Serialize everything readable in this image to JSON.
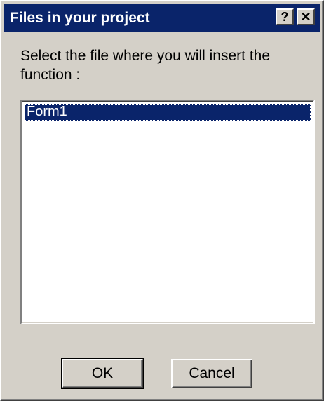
{
  "window": {
    "title": "Files in your project",
    "help_button": "?",
    "close_button": "✕"
  },
  "prompt": "Select the file where you will insert the function :",
  "file_list": {
    "items": [
      {
        "label": "Form1",
        "selected": true
      }
    ]
  },
  "buttons": {
    "ok_label": "OK",
    "cancel_label": "Cancel"
  },
  "colors": {
    "titlebar": "#0a246a",
    "selection": "#0a246a",
    "face": "#d4d0c8"
  }
}
